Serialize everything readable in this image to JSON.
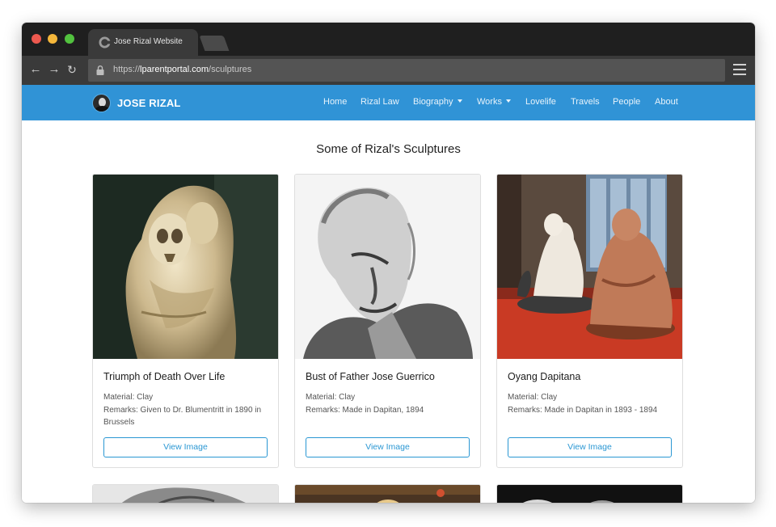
{
  "browser": {
    "tab_title": "Jose Rizal Website",
    "url_prefix": "https://",
    "url_host": "lparentportal.com",
    "url_path": "/sculptures"
  },
  "site": {
    "brand": "JOSE RIZAL",
    "nav": [
      {
        "label": "Home"
      },
      {
        "label": "Rizal Law"
      },
      {
        "label": "Biography"
      },
      {
        "label": "Works"
      },
      {
        "label": "Lovelife"
      },
      {
        "label": "Travels"
      },
      {
        "label": "People"
      },
      {
        "label": "About"
      }
    ],
    "accent_color": "#3093d6"
  },
  "main": {
    "title": "Some of Rizal's Sculptures",
    "cards": [
      {
        "title": "Triumph of Death Over Life",
        "material": "Material: Clay",
        "remarks": "Remarks: Given to Dr. Blumentritt in 1890 in Brussels",
        "button": "View Image"
      },
      {
        "title": "Bust of Father Jose Guerrico",
        "material": "Material: Clay",
        "remarks": "Remarks: Made in Dapitan, 1894",
        "button": "View Image"
      },
      {
        "title": "Oyang Dapitana",
        "material": "Material: Clay",
        "remarks": "Remarks: Made in Dapitan in 1893 - 1894",
        "button": "View Image"
      }
    ]
  }
}
